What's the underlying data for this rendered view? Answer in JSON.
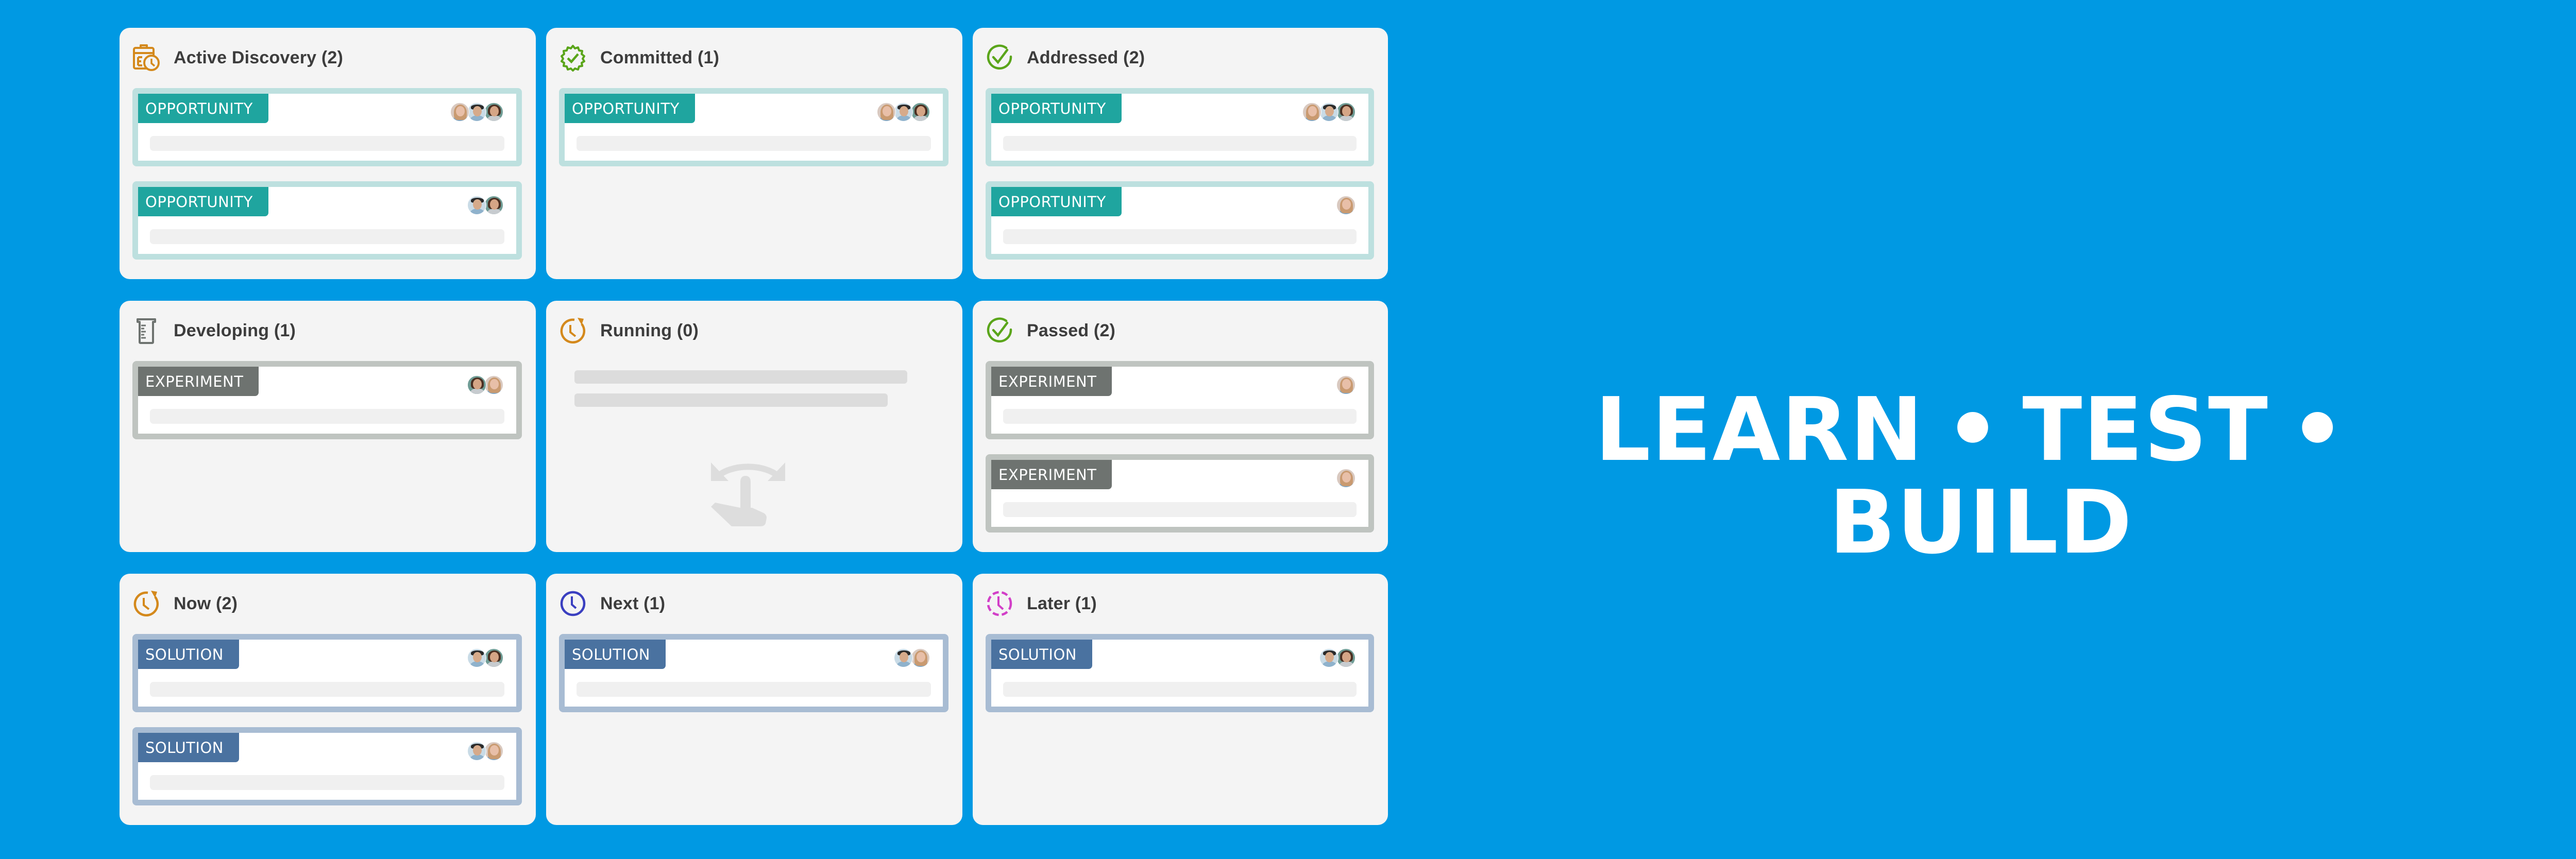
{
  "colors": {
    "background": "#0099e3",
    "panel": "#f4f4f4",
    "opportunity_tag": "#1fa59f",
    "opportunity_border": "#bde0df",
    "experiment_tag": "#6e7370",
    "experiment_border": "#bfc4c0",
    "solution_tag": "#4a72a0",
    "solution_border": "#a8bcd3",
    "icon_orange": "#d4891c",
    "icon_green": "#5aa51a",
    "icon_gray": "#6e7370",
    "icon_blue": "#3a3fc0",
    "icon_magenta": "#d23fc8"
  },
  "tagline": {
    "words": [
      "LEARN",
      "TEST",
      "BUILD"
    ],
    "separator": "•"
  },
  "panels": [
    {
      "title": "Active Discovery (2)",
      "icon": "clipboard-clock-icon",
      "cards": [
        {
          "type": "opportunity",
          "tag": "OPPORTUNITY",
          "avatars": [
            "a-blonde",
            "a-man",
            "a-curly"
          ]
        },
        {
          "type": "opportunity",
          "tag": "OPPORTUNITY",
          "avatars": [
            "a-man",
            "a-curly"
          ]
        }
      ]
    },
    {
      "title": "Committed (1)",
      "icon": "badge-check-icon",
      "cards": [
        {
          "type": "opportunity",
          "tag": "OPPORTUNITY",
          "avatars": [
            "a-blonde",
            "a-man",
            "a-curly"
          ]
        }
      ]
    },
    {
      "title": "Addressed (2)",
      "icon": "circle-check-icon",
      "cards": [
        {
          "type": "opportunity",
          "tag": "OPPORTUNITY",
          "avatars": [
            "a-blonde",
            "a-man",
            "a-curly"
          ]
        },
        {
          "type": "opportunity",
          "tag": "OPPORTUNITY",
          "avatars": [
            "a-blonde"
          ]
        }
      ]
    },
    {
      "title": "Developing (1)",
      "icon": "beaker-icon",
      "cards": [
        {
          "type": "experiment",
          "tag": "EXPERIMENT",
          "avatars": [
            "a-curly",
            "a-blonde"
          ]
        }
      ]
    },
    {
      "title": "Running (0)",
      "icon": "clock-refresh-icon",
      "cards": [],
      "empty": true
    },
    {
      "title": "Passed (2)",
      "icon": "circle-check-icon",
      "cards": [
        {
          "type": "experiment",
          "tag": "EXPERIMENT",
          "avatars": [
            "a-blonde"
          ]
        },
        {
          "type": "experiment",
          "tag": "EXPERIMENT",
          "avatars": [
            "a-blonde"
          ]
        }
      ]
    },
    {
      "title": "Now (2)",
      "icon": "clock-refresh-icon",
      "cards": [
        {
          "type": "solution",
          "tag": "SOLUTION",
          "avatars": [
            "a-man",
            "a-curly"
          ]
        },
        {
          "type": "solution",
          "tag": "SOLUTION",
          "avatars": [
            "a-man",
            "a-blonde"
          ]
        }
      ]
    },
    {
      "title": "Next (1)",
      "icon": "clock-icon",
      "cards": [
        {
          "type": "solution",
          "tag": "SOLUTION",
          "avatars": [
            "a-man",
            "a-blonde"
          ]
        }
      ]
    },
    {
      "title": "Later (1)",
      "icon": "dashed-clock-icon",
      "cards": [
        {
          "type": "solution",
          "tag": "SOLUTION",
          "avatars": [
            "a-man",
            "a-curly"
          ]
        }
      ]
    }
  ]
}
